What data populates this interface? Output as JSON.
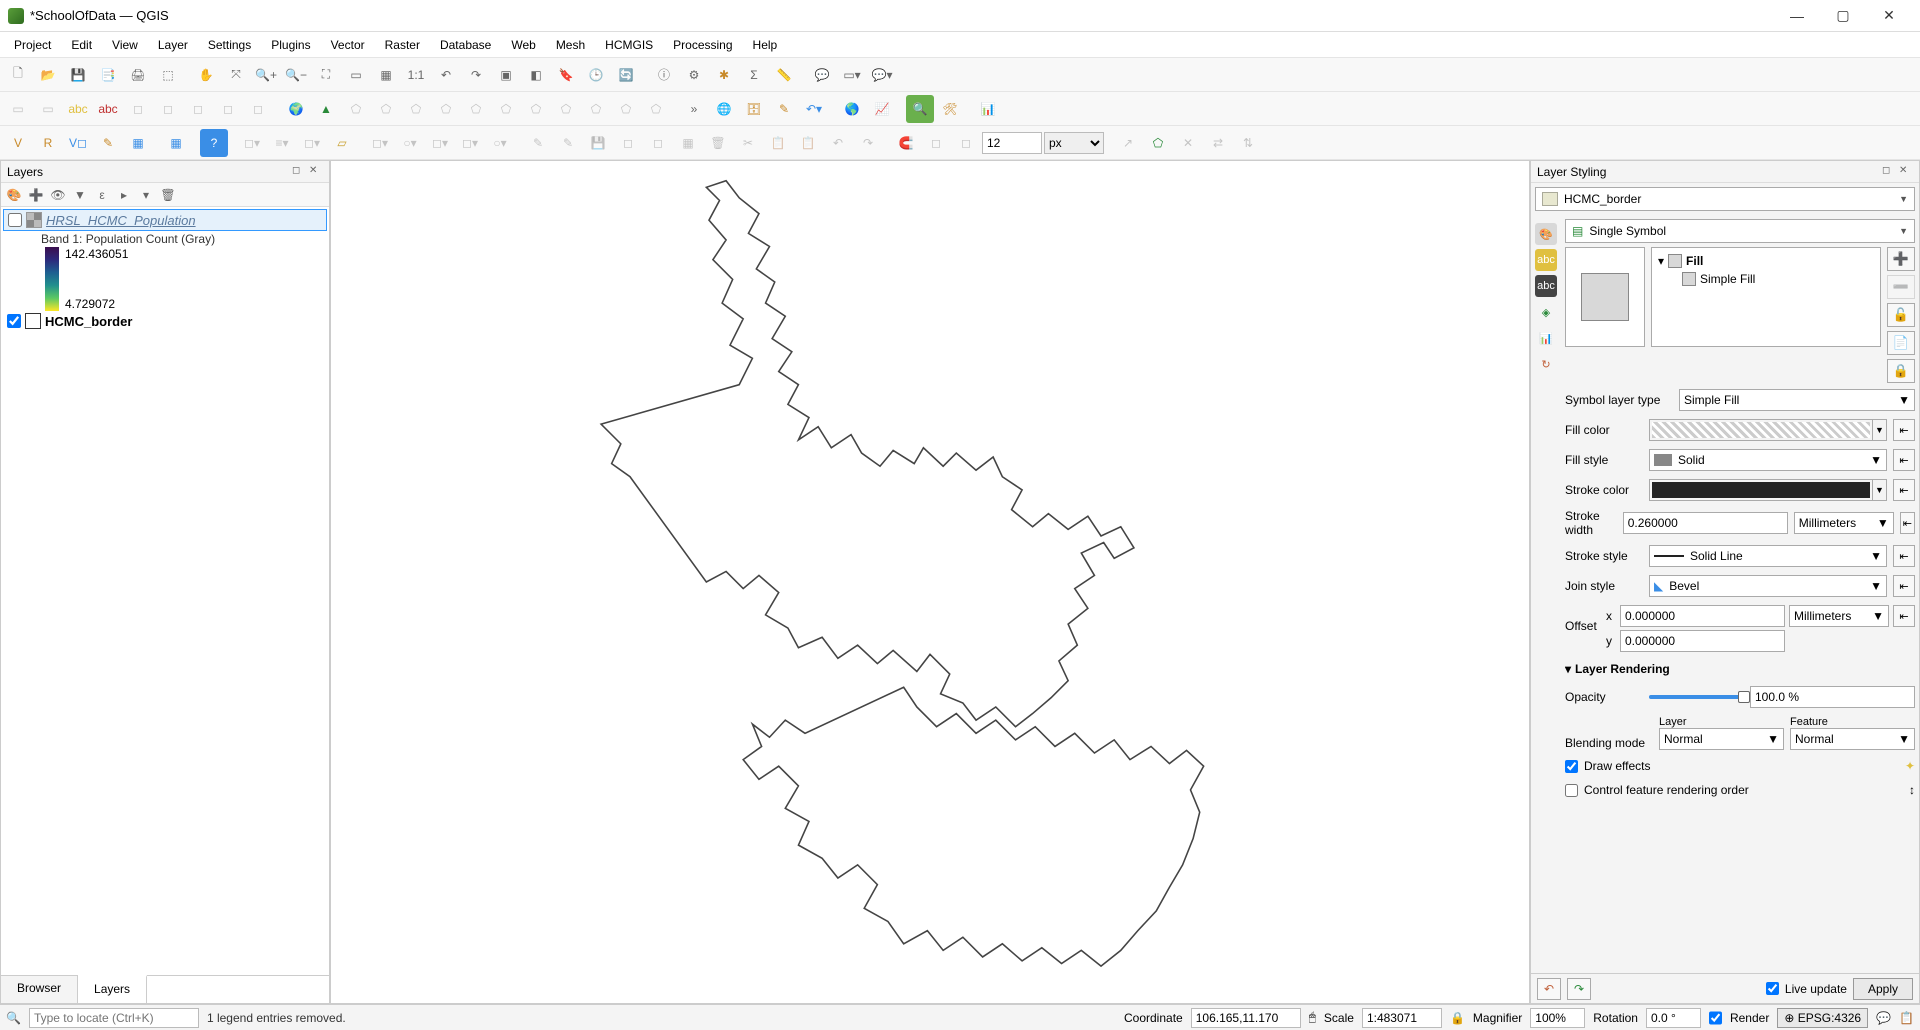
{
  "window": {
    "title": "*SchoolOfData — QGIS"
  },
  "menu": [
    "Project",
    "Edit",
    "View",
    "Layer",
    "Settings",
    "Plugins",
    "Vector",
    "Raster",
    "Database",
    "Web",
    "Mesh",
    "HCMGIS",
    "Processing",
    "Help"
  ],
  "toolbar3": {
    "spin_value": "12",
    "unit": "px"
  },
  "layers_panel": {
    "title": "Layers",
    "items": [
      {
        "name": "HRSL_HCMC_Population",
        "checked": false,
        "italic": true,
        "band": "Band 1: Population Count (Gray)",
        "max": "142.436051",
        "min": "4.729072"
      },
      {
        "name": "HCMC_border",
        "checked": true,
        "italic": false
      }
    ],
    "tabs": [
      "Browser",
      "Layers"
    ],
    "active_tab": 1
  },
  "style_panel": {
    "title": "Layer Styling",
    "layer": "HCMC_border",
    "renderer": "Single Symbol",
    "tree_root": "Fill",
    "tree_child": "Simple Fill",
    "symbol_layer_type_label": "Symbol layer type",
    "symbol_layer_type": "Simple Fill",
    "fill_color_label": "Fill color",
    "fill_style_label": "Fill style",
    "fill_style": "Solid",
    "stroke_color_label": "Stroke color",
    "stroke_width_label": "Stroke width",
    "stroke_width": "0.260000",
    "stroke_width_unit": "Millimeters",
    "stroke_style_label": "Stroke style",
    "stroke_style": "Solid Line",
    "join_style_label": "Join style",
    "join_style": "Bevel",
    "offset_label": "Offset",
    "offset_x_label": "x",
    "offset_x": "0.000000",
    "offset_y_label": "y",
    "offset_y": "0.000000",
    "offset_unit": "Millimeters",
    "layer_rendering": "Layer Rendering",
    "opacity_label": "Opacity",
    "opacity": "100.0 %",
    "blending_label": "Blending mode",
    "blending_layer_label": "Layer",
    "blending_feature_label": "Feature",
    "blending_layer": "Normal",
    "blending_feature": "Normal",
    "draw_effects": "Draw effects",
    "control_order": "Control feature rendering order",
    "live_update": "Live update",
    "apply": "Apply"
  },
  "status": {
    "locator_placeholder": "Type to locate (Ctrl+K)",
    "message": "1 legend entries removed.",
    "coordinate_label": "Coordinate",
    "coordinate": "106.165,11.170",
    "scale_label": "Scale",
    "scale": "1:483071",
    "magnifier_label": "Magnifier",
    "magnifier": "100%",
    "rotation_label": "Rotation",
    "rotation": "0.0 °",
    "render": "Render",
    "crs": "EPSG:4326"
  }
}
